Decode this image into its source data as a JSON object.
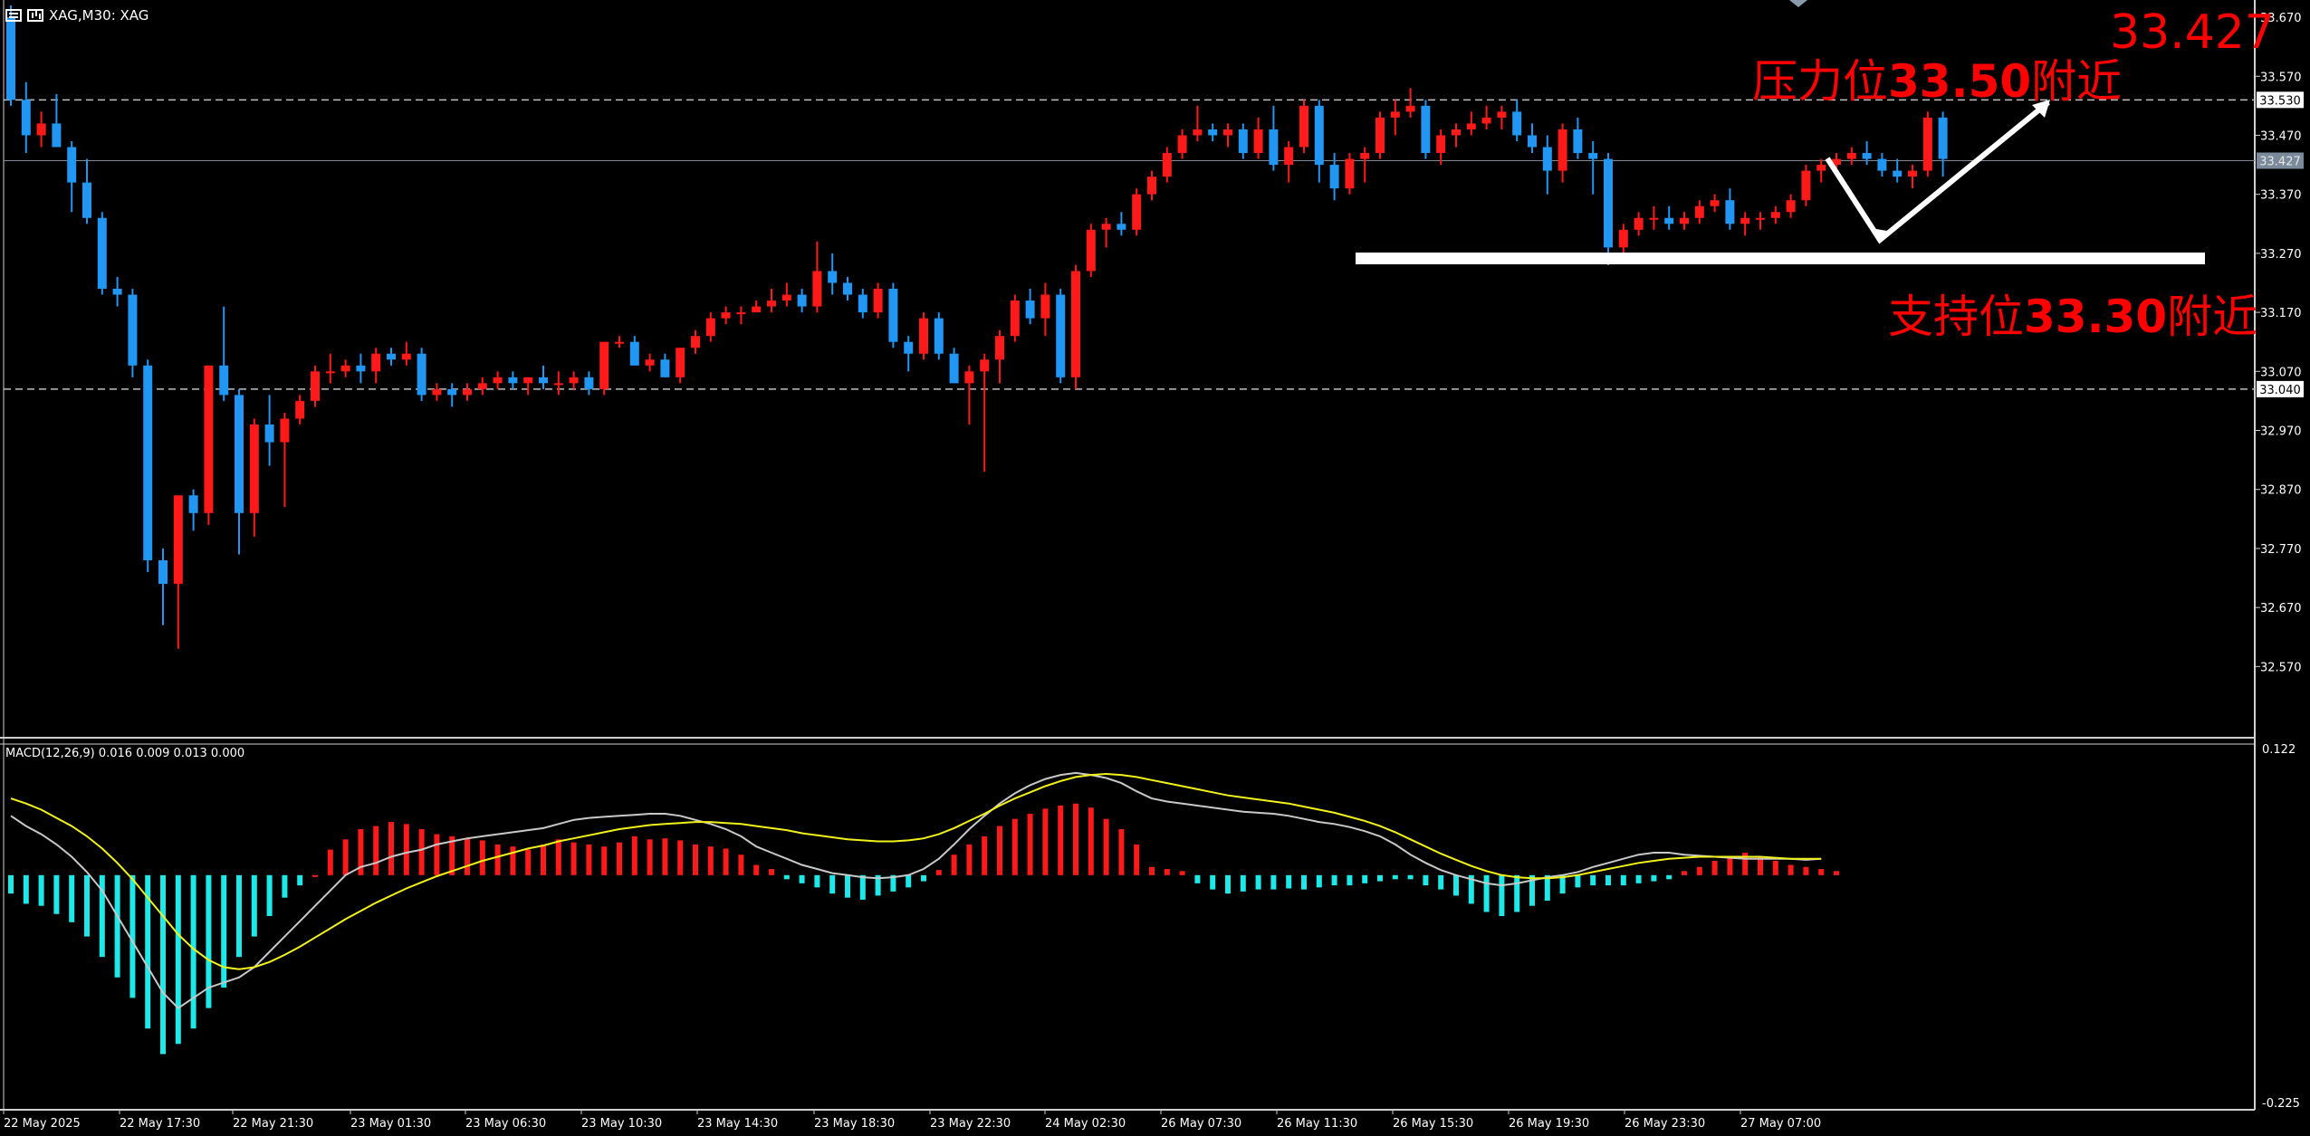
{
  "header": {
    "symbol_line": "XAG,M30:  XAG",
    "list_icon": "list-icon",
    "chart_icon": "chart-icon"
  },
  "annotations": {
    "resistance_prefix": "压力位",
    "resistance_value": "33.50",
    "resistance_suffix": "附近",
    "support_prefix": "支持位",
    "support_value": "33.30",
    "support_suffix": "附近",
    "current_price_big": "33.427"
  },
  "price_axis": {
    "ticks": [
      "33.670",
      "33.570",
      "33.470",
      "33.370",
      "33.270",
      "33.170",
      "33.070",
      "32.970",
      "32.870",
      "32.770",
      "32.670",
      "32.570"
    ],
    "labels": {
      "upper_line": "33.530",
      "current": "33.427",
      "lower_line": "33.040"
    }
  },
  "macd": {
    "label": "MACD(12,26,9) 0.016 0.009 0.013 0.000",
    "axis_top": "0.122",
    "axis_bottom": "-0.225"
  },
  "time_axis": {
    "labels": [
      "22 May 2025",
      "22 May 17:30",
      "22 May 21:30",
      "23 May 01:30",
      "23 May 06:30",
      "23 May 10:30",
      "23 May 14:30",
      "23 May 18:30",
      "23 May 22:30",
      "24 May 02:30",
      "26 May 07:30",
      "26 May 11:30",
      "26 May 15:30",
      "26 May 19:30",
      "26 May 23:30",
      "27 May 07:00"
    ]
  },
  "colors": {
    "background": "#000000",
    "bull": "#ff1a1a",
    "bear": "#2196f3",
    "macd_pos": "#ff1a1a",
    "macd_neg": "#1de9e9",
    "macd_line": "#c8c8c8",
    "signal_line": "#f2f21a",
    "annotation": "#ff0000",
    "grid_text": "#ffffff"
  },
  "chart_data": {
    "type": "candlestick",
    "symbol": "XAG",
    "timeframe": "M30",
    "ylim": [
      32.5,
      33.69
    ],
    "horizontal_levels": [
      33.53,
      33.427,
      33.04
    ],
    "support_zone": 33.28,
    "candles": [
      [
        33.67,
        33.69,
        33.52,
        33.53
      ],
      [
        33.53,
        33.56,
        33.44,
        33.47
      ],
      [
        33.47,
        33.51,
        33.45,
        33.49
      ],
      [
        33.49,
        33.54,
        33.45,
        33.45
      ],
      [
        33.45,
        33.46,
        33.34,
        33.39
      ],
      [
        33.39,
        33.43,
        33.32,
        33.33
      ],
      [
        33.33,
        33.34,
        33.2,
        33.21
      ],
      [
        33.21,
        33.23,
        33.18,
        33.2
      ],
      [
        33.2,
        33.21,
        33.06,
        33.08
      ],
      [
        33.08,
        33.09,
        32.73,
        32.75
      ],
      [
        32.75,
        32.77,
        32.64,
        32.71
      ],
      [
        32.71,
        32.86,
        32.6,
        32.86
      ],
      [
        32.86,
        32.87,
        32.8,
        32.83
      ],
      [
        32.83,
        33.08,
        32.81,
        33.08
      ],
      [
        33.08,
        33.18,
        33.02,
        33.03
      ],
      [
        33.03,
        33.04,
        32.76,
        32.83
      ],
      [
        32.83,
        32.99,
        32.79,
        32.98
      ],
      [
        32.98,
        33.03,
        32.91,
        32.95
      ],
      [
        32.95,
        33.0,
        32.84,
        32.99
      ],
      [
        32.99,
        33.03,
        32.98,
        33.02
      ],
      [
        33.02,
        33.08,
        33.01,
        33.07
      ],
      [
        33.07,
        33.1,
        33.05,
        33.07
      ],
      [
        33.07,
        33.09,
        33.06,
        33.08
      ],
      [
        33.08,
        33.1,
        33.05,
        33.07
      ],
      [
        33.07,
        33.11,
        33.05,
        33.1
      ],
      [
        33.1,
        33.11,
        33.08,
        33.09
      ],
      [
        33.09,
        33.12,
        33.08,
        33.1
      ],
      [
        33.1,
        33.11,
        33.02,
        33.03
      ],
      [
        33.03,
        33.05,
        33.02,
        33.04
      ],
      [
        33.04,
        33.05,
        33.01,
        33.03
      ],
      [
        33.03,
        33.05,
        33.02,
        33.04
      ],
      [
        33.04,
        33.06,
        33.03,
        33.05
      ],
      [
        33.05,
        33.07,
        33.04,
        33.06
      ],
      [
        33.06,
        33.07,
        33.04,
        33.05
      ],
      [
        33.05,
        33.06,
        33.03,
        33.06
      ],
      [
        33.06,
        33.08,
        33.04,
        33.05
      ],
      [
        33.05,
        33.07,
        33.03,
        33.05
      ],
      [
        33.05,
        33.07,
        33.04,
        33.06
      ],
      [
        33.06,
        33.07,
        33.03,
        33.04
      ],
      [
        33.04,
        33.12,
        33.03,
        33.12
      ],
      [
        33.12,
        33.13,
        33.11,
        33.12
      ],
      [
        33.12,
        33.13,
        33.08,
        33.08
      ],
      [
        33.08,
        33.1,
        33.07,
        33.09
      ],
      [
        33.09,
        33.1,
        33.06,
        33.06
      ],
      [
        33.06,
        33.11,
        33.05,
        33.11
      ],
      [
        33.11,
        33.14,
        33.1,
        33.13
      ],
      [
        33.13,
        33.17,
        33.12,
        33.16
      ],
      [
        33.16,
        33.18,
        33.15,
        33.17
      ],
      [
        33.17,
        33.18,
        33.15,
        33.17
      ],
      [
        33.17,
        33.19,
        33.17,
        33.18
      ],
      [
        33.18,
        33.21,
        33.17,
        33.19
      ],
      [
        33.19,
        33.22,
        33.18,
        33.2
      ],
      [
        33.2,
        33.21,
        33.17,
        33.18
      ],
      [
        33.18,
        33.29,
        33.17,
        33.24
      ],
      [
        33.24,
        33.27,
        33.2,
        33.22
      ],
      [
        33.22,
        33.23,
        33.19,
        33.2
      ],
      [
        33.2,
        33.21,
        33.16,
        33.17
      ],
      [
        33.17,
        33.22,
        33.16,
        33.21
      ],
      [
        33.21,
        33.22,
        33.11,
        33.12
      ],
      [
        33.12,
        33.13,
        33.07,
        33.1
      ],
      [
        33.1,
        33.17,
        33.09,
        33.16
      ],
      [
        33.16,
        33.17,
        33.09,
        33.1
      ],
      [
        33.1,
        33.11,
        33.05,
        33.05
      ],
      [
        33.05,
        33.08,
        32.98,
        33.07
      ],
      [
        33.07,
        33.1,
        32.9,
        33.09
      ],
      [
        33.09,
        33.14,
        33.05,
        33.13
      ],
      [
        33.13,
        33.2,
        33.12,
        33.19
      ],
      [
        33.19,
        33.21,
        33.15,
        33.16
      ],
      [
        33.16,
        33.22,
        33.13,
        33.2
      ],
      [
        33.2,
        33.21,
        33.05,
        33.06
      ],
      [
        33.06,
        33.25,
        33.04,
        33.24
      ],
      [
        33.24,
        33.32,
        33.23,
        33.31
      ],
      [
        33.31,
        33.33,
        33.28,
        33.32
      ],
      [
        33.32,
        33.34,
        33.3,
        33.31
      ],
      [
        33.31,
        33.38,
        33.3,
        33.37
      ],
      [
        33.37,
        33.41,
        33.36,
        33.4
      ],
      [
        33.4,
        33.45,
        33.39,
        33.44
      ],
      [
        33.44,
        33.48,
        33.43,
        33.47
      ],
      [
        33.47,
        33.52,
        33.46,
        33.48
      ],
      [
        33.48,
        33.49,
        33.46,
        33.47
      ],
      [
        33.47,
        33.49,
        33.45,
        33.48
      ],
      [
        33.48,
        33.49,
        33.43,
        33.44
      ],
      [
        33.44,
        33.5,
        33.43,
        33.48
      ],
      [
        33.48,
        33.52,
        33.41,
        33.42
      ],
      [
        33.42,
        33.46,
        33.39,
        33.45
      ],
      [
        33.45,
        33.53,
        33.44,
        33.52
      ],
      [
        33.52,
        33.53,
        33.39,
        33.42
      ],
      [
        33.42,
        33.44,
        33.36,
        33.38
      ],
      [
        33.38,
        33.44,
        33.37,
        33.43
      ],
      [
        33.43,
        33.45,
        33.39,
        33.44
      ],
      [
        33.44,
        33.51,
        33.43,
        33.5
      ],
      [
        33.5,
        33.53,
        33.47,
        33.51
      ],
      [
        33.51,
        33.55,
        33.5,
        33.52
      ],
      [
        33.52,
        33.53,
        33.43,
        33.44
      ],
      [
        33.44,
        33.48,
        33.42,
        33.47
      ],
      [
        33.47,
        33.49,
        33.45,
        33.48
      ],
      [
        33.48,
        33.51,
        33.47,
        33.49
      ],
      [
        33.49,
        33.52,
        33.48,
        33.5
      ],
      [
        33.5,
        33.52,
        33.48,
        33.51
      ],
      [
        33.51,
        33.53,
        33.46,
        33.47
      ],
      [
        33.47,
        33.49,
        33.44,
        33.45
      ],
      [
        33.45,
        33.47,
        33.37,
        33.41
      ],
      [
        33.41,
        33.49,
        33.39,
        33.48
      ],
      [
        33.48,
        33.5,
        33.43,
        33.44
      ],
      [
        33.44,
        33.46,
        33.37,
        33.43
      ],
      [
        33.43,
        33.44,
        33.25,
        33.28
      ],
      [
        33.28,
        33.32,
        33.26,
        33.31
      ],
      [
        33.31,
        33.34,
        33.3,
        33.33
      ],
      [
        33.33,
        33.35,
        33.31,
        33.33
      ],
      [
        33.33,
        33.35,
        33.31,
        33.32
      ],
      [
        33.32,
        33.34,
        33.31,
        33.33
      ],
      [
        33.33,
        33.36,
        33.32,
        33.35
      ],
      [
        33.35,
        33.37,
        33.34,
        33.36
      ],
      [
        33.36,
        33.38,
        33.31,
        33.32
      ],
      [
        33.32,
        33.34,
        33.3,
        33.33
      ],
      [
        33.33,
        33.34,
        33.31,
        33.33
      ],
      [
        33.33,
        33.35,
        33.32,
        33.34
      ],
      [
        33.34,
        33.37,
        33.33,
        33.36
      ],
      [
        33.36,
        33.42,
        33.35,
        33.41
      ],
      [
        33.41,
        33.43,
        33.39,
        33.42
      ],
      [
        33.42,
        33.44,
        33.41,
        33.43
      ],
      [
        33.43,
        33.45,
        33.42,
        33.44
      ],
      [
        33.44,
        33.46,
        33.42,
        33.43
      ],
      [
        33.43,
        33.44,
        33.4,
        33.41
      ],
      [
        33.41,
        33.43,
        33.39,
        33.4
      ],
      [
        33.4,
        33.42,
        33.38,
        33.41
      ],
      [
        33.41,
        33.51,
        33.4,
        33.5
      ],
      [
        33.5,
        33.51,
        33.4,
        33.43
      ]
    ],
    "macd_histogram": [
      -0.018,
      -0.028,
      -0.03,
      -0.038,
      -0.046,
      -0.06,
      -0.08,
      -0.1,
      -0.12,
      -0.15,
      -0.175,
      -0.165,
      -0.15,
      -0.13,
      -0.11,
      -0.08,
      -0.06,
      -0.04,
      -0.022,
      -0.01,
      0.0,
      0.025,
      0.035,
      0.045,
      0.048,
      0.052,
      0.05,
      0.045,
      0.04,
      0.038,
      0.036,
      0.034,
      0.03,
      0.028,
      0.025,
      0.03,
      0.035,
      0.032,
      0.03,
      0.028,
      0.032,
      0.038,
      0.035,
      0.036,
      0.034,
      0.03,
      0.028,
      0.026,
      0.02,
      0.01,
      0.006,
      -0.004,
      -0.008,
      -0.012,
      -0.018,
      -0.022,
      -0.024,
      -0.02,
      -0.016,
      -0.012,
      -0.006,
      0.005,
      0.02,
      0.03,
      0.038,
      0.048,
      0.055,
      0.06,
      0.065,
      0.068,
      0.07,
      0.066,
      0.055,
      0.045,
      0.03,
      0.008,
      0.006,
      0.004,
      -0.008,
      -0.014,
      -0.018,
      -0.016,
      -0.014,
      -0.014,
      -0.013,
      -0.014,
      -0.012,
      -0.01,
      -0.01,
      -0.008,
      -0.006,
      -0.004,
      -0.004,
      -0.01,
      -0.014,
      -0.02,
      -0.028,
      -0.036,
      -0.04,
      -0.036,
      -0.03,
      -0.025,
      -0.018,
      -0.012,
      -0.01,
      -0.01,
      -0.01,
      -0.008,
      -0.006,
      -0.004,
      0.004,
      0.008,
      0.014,
      0.018,
      0.022,
      0.018,
      0.014,
      0.01,
      0.008,
      0.006,
      0.004
    ],
    "macd_line": [
      0.058,
      0.048,
      0.04,
      0.03,
      0.018,
      0.003,
      -0.015,
      -0.04,
      -0.065,
      -0.09,
      -0.115,
      -0.13,
      -0.12,
      -0.11,
      -0.105,
      -0.1,
      -0.09,
      -0.075,
      -0.06,
      -0.045,
      -0.03,
      -0.015,
      0.0,
      0.008,
      0.012,
      0.018,
      0.022,
      0.025,
      0.03,
      0.033,
      0.036,
      0.038,
      0.04,
      0.042,
      0.044,
      0.046,
      0.05,
      0.054,
      0.056,
      0.057,
      0.058,
      0.059,
      0.06,
      0.06,
      0.058,
      0.054,
      0.05,
      0.045,
      0.038,
      0.028,
      0.022,
      0.016,
      0.01,
      0.006,
      0.002,
      0.0,
      -0.002,
      -0.003,
      -0.002,
      0.0,
      0.006,
      0.016,
      0.03,
      0.045,
      0.058,
      0.07,
      0.08,
      0.088,
      0.094,
      0.098,
      0.1,
      0.098,
      0.095,
      0.09,
      0.082,
      0.075,
      0.072,
      0.07,
      0.068,
      0.066,
      0.064,
      0.062,
      0.061,
      0.06,
      0.058,
      0.055,
      0.052,
      0.05,
      0.047,
      0.043,
      0.038,
      0.03,
      0.02,
      0.012,
      0.005,
      0.0,
      -0.004,
      -0.008,
      -0.01,
      -0.008,
      -0.005,
      -0.002,
      0.0,
      0.003,
      0.008,
      0.012,
      0.016,
      0.02,
      0.022,
      0.022,
      0.02,
      0.019,
      0.018,
      0.017,
      0.016,
      0.016,
      0.016,
      0.016,
      0.015,
      0.016
    ],
    "signal_line": [
      0.075,
      0.07,
      0.064,
      0.056,
      0.048,
      0.038,
      0.026,
      0.012,
      -0.004,
      -0.022,
      -0.04,
      -0.058,
      -0.072,
      -0.083,
      -0.09,
      -0.092,
      -0.09,
      -0.085,
      -0.078,
      -0.07,
      -0.061,
      -0.052,
      -0.043,
      -0.035,
      -0.027,
      -0.02,
      -0.013,
      -0.007,
      -0.001,
      0.004,
      0.009,
      0.014,
      0.018,
      0.022,
      0.026,
      0.029,
      0.033,
      0.036,
      0.039,
      0.042,
      0.045,
      0.047,
      0.049,
      0.05,
      0.051,
      0.052,
      0.052,
      0.051,
      0.05,
      0.048,
      0.046,
      0.044,
      0.041,
      0.039,
      0.037,
      0.035,
      0.034,
      0.033,
      0.033,
      0.034,
      0.036,
      0.04,
      0.046,
      0.053,
      0.06,
      0.068,
      0.075,
      0.081,
      0.087,
      0.092,
      0.096,
      0.098,
      0.099,
      0.098,
      0.096,
      0.093,
      0.09,
      0.087,
      0.084,
      0.081,
      0.078,
      0.076,
      0.074,
      0.072,
      0.07,
      0.067,
      0.064,
      0.061,
      0.057,
      0.053,
      0.048,
      0.042,
      0.035,
      0.028,
      0.021,
      0.015,
      0.009,
      0.004,
      0.0,
      -0.002,
      -0.003,
      -0.003,
      -0.002,
      0.0,
      0.003,
      0.006,
      0.009,
      0.012,
      0.014,
      0.016,
      0.017,
      0.018,
      0.018,
      0.018,
      0.018,
      0.018,
      0.017,
      0.016,
      0.016,
      0.016
    ]
  }
}
